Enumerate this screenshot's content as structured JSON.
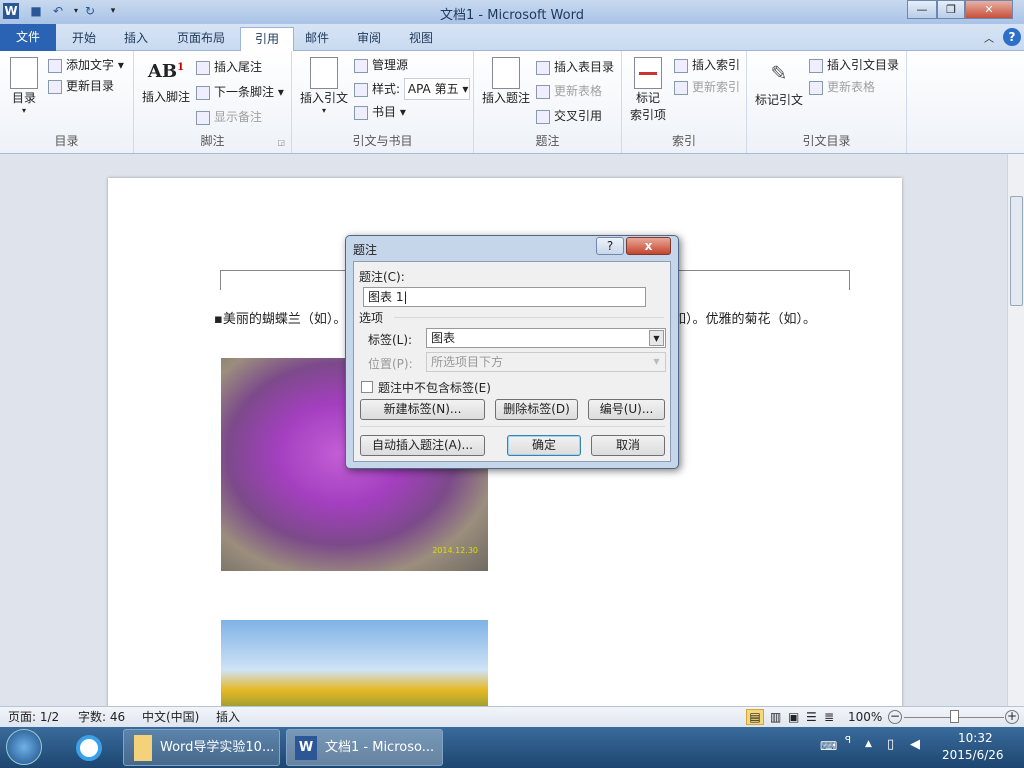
{
  "window": {
    "title": "文档1  -  Microsoft Word"
  },
  "tabs": [
    "文件",
    "开始",
    "插入",
    "页面布局",
    "引用",
    "邮件",
    "审阅",
    "视图"
  ],
  "ribbon": {
    "toc": {
      "label": "目录",
      "big": "目录",
      "add_text": "添加文字",
      "update": "更新目录"
    },
    "footnote": {
      "label": "脚注",
      "big": "插入脚注",
      "endnote": "插入尾注",
      "next": "下一条脚注",
      "show": "显示备注"
    },
    "citation": {
      "label": "引文与书目",
      "big": "插入引文",
      "manage": "管理源",
      "style_label": "样式:",
      "style_value": "APA 第五",
      "bib": "书目"
    },
    "caption": {
      "label": "题注",
      "big": "插入题注",
      "table_figs": "插入表目录",
      "update_table": "更新表格",
      "crossref": "交叉引用"
    },
    "index": {
      "label": "索引",
      "big": "标记\n索引项",
      "big1": "标记",
      "big2": "索引项",
      "insert": "插入索引",
      "update": "更新索引"
    },
    "toa": {
      "label": "引文目录",
      "big": "标记引文",
      "insert": "插入引文目录",
      "update": "更新表格"
    }
  },
  "document": {
    "line_left": "美丽的蝴蝶兰（如）。",
    "line_right": "如）。优雅的菊花（如）。",
    "photo_date": "2014.12.30"
  },
  "dialog": {
    "title": "题注",
    "caption_label": "题注(C):",
    "caption_value": "图表 1",
    "options": "选项",
    "tag_label": "标签(L):",
    "tag_value": "图表",
    "pos_label": "位置(P):",
    "pos_value": "所选项目下方",
    "exclude": "题注中不包含标签(E)",
    "new_label": "新建标签(N)...",
    "delete_label": "删除标签(D)",
    "numbering": "编号(U)...",
    "autocaption": "自动插入题注(A)...",
    "ok": "确定",
    "cancel": "取消",
    "help": "?",
    "close": "x"
  },
  "status": {
    "page": "页面: 1/2",
    "words": "字数: 46",
    "lang": "中文(中国)",
    "mode": "插入",
    "zoom": "100%"
  },
  "taskbar": {
    "item1": "Word导学实验10...",
    "item2": "文档1 - Microso...",
    "time": "10:32",
    "date": "2015/6/26"
  }
}
